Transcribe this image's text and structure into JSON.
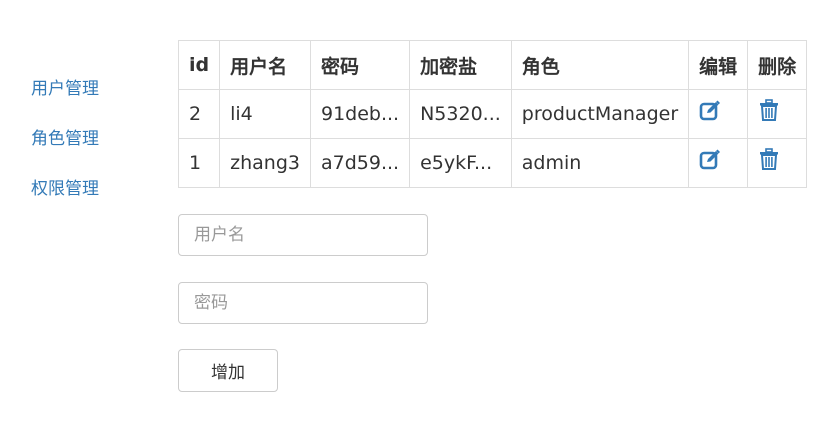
{
  "sidebar": {
    "items": [
      {
        "label": "用户管理"
      },
      {
        "label": "角色管理"
      },
      {
        "label": "权限管理"
      }
    ]
  },
  "table": {
    "headers": {
      "id": "id",
      "username": "用户名",
      "password": "密码",
      "salt": "加密盐",
      "role": "角色",
      "edit": "编辑",
      "delete": "删除"
    },
    "rows": [
      {
        "id": "2",
        "username": "li4",
        "password": "91deb...",
        "salt": "N5320...",
        "role": "productManager",
        "edit_icon": "edit-icon",
        "delete_icon": "trash-icon"
      },
      {
        "id": "1",
        "username": "zhang3",
        "password": "a7d59...",
        "salt": "e5ykF...",
        "role": "admin",
        "edit_icon": "edit-icon",
        "delete_icon": "trash-icon"
      }
    ]
  },
  "form": {
    "username_placeholder": "用户名",
    "password_placeholder": "密码",
    "add_label": "增加"
  },
  "colors": {
    "link": "#337ab7",
    "border": "#dddddd",
    "text": "#333333"
  }
}
